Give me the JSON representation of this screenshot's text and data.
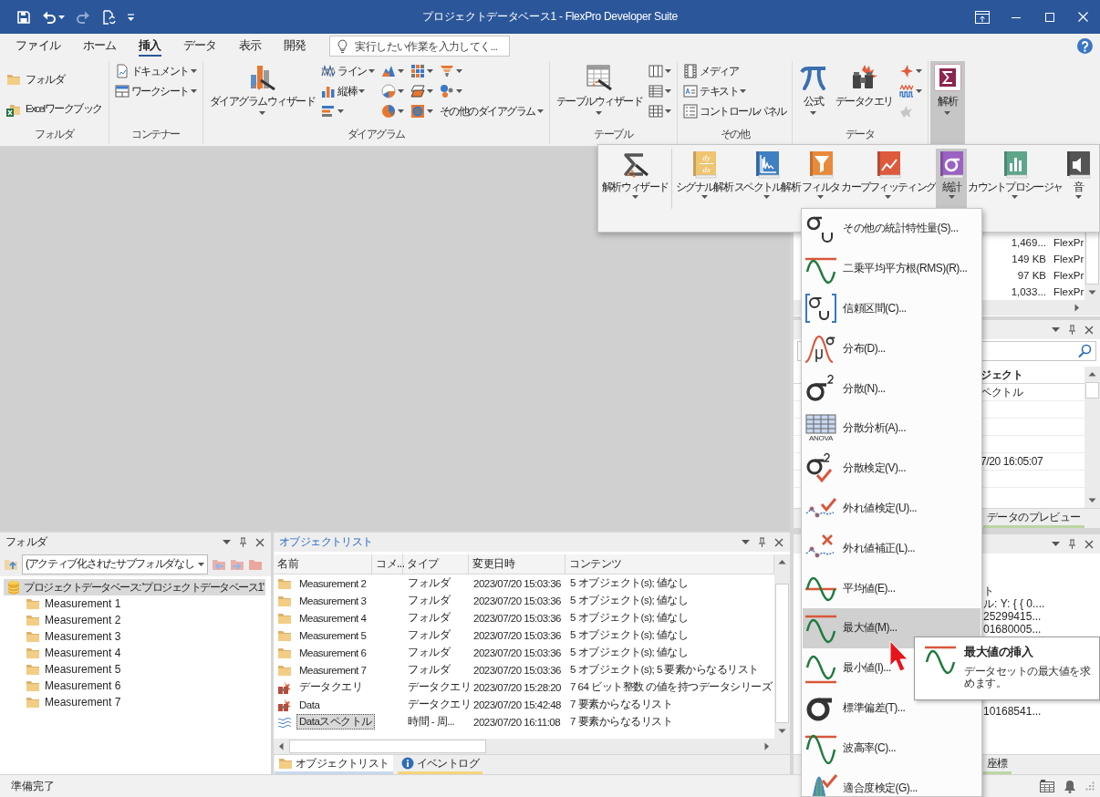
{
  "title_bar": {
    "title": "プロジェクトデータベース1 - FlexPro Developer Suite",
    "quick_access": [
      {
        "dropdown": false,
        "disabled": false
      },
      {
        "dropdown": true,
        "disabled": false
      },
      {
        "dropdown": false,
        "disabled": true
      },
      {
        "dropdown": false,
        "disabled": false
      },
      {
        "dropdown": true,
        "disabled": false
      }
    ]
  },
  "menu": {
    "tabs": [
      {
        "label": "ファイル",
        "selected": false
      },
      {
        "label": "ホーム",
        "selected": false
      },
      {
        "label": "挿入",
        "selected": true
      },
      {
        "label": "データ",
        "selected": false
      },
      {
        "label": "表示",
        "selected": false
      },
      {
        "label": "開発",
        "selected": false
      }
    ],
    "search": {
      "placeholder": "実行したい作業を入力してく..."
    }
  },
  "ribbon": {
    "groups": [
      {
        "label": "フォルダ",
        "buttons": [
          {
            "kind": "medium",
            "label": "フォルダ",
            "dropdown": false
          },
          {
            "kind": "medium",
            "label": "Excelワークブック",
            "dropdown": false
          }
        ]
      },
      {
        "label": "コンテナー",
        "buttons": [
          {
            "kind": "small",
            "label": "ドキュメント",
            "dropdown": true
          },
          {
            "kind": "small",
            "label": "ワークシート",
            "dropdown": true
          }
        ]
      },
      {
        "label": "ダイアグラム",
        "buttons": [
          {
            "kind": "large",
            "label": "ダイアグラムウィザード",
            "dropdown": true
          },
          {
            "kind": "small",
            "label": "ライン",
            "dropdown": true
          },
          {
            "kind": "small",
            "label": "縦棒",
            "dropdown": true
          },
          {
            "kind": "small",
            "dropdown": true
          },
          {
            "kind": "small",
            "dropdown": true
          },
          {
            "kind": "small",
            "dropdown": true
          },
          {
            "kind": "small",
            "dropdown": true
          },
          {
            "kind": "small",
            "dropdown": true
          },
          {
            "kind": "small",
            "dropdown": true
          },
          {
            "kind": "small",
            "dropdown": true
          },
          {
            "kind": "small",
            "dropdown": true
          },
          {
            "kind": "small",
            "dropdown": true
          },
          {
            "kind": "small",
            "label": "その他のダイアグラム",
            "dropdown": true
          }
        ]
      },
      {
        "label": "テーブル",
        "buttons": [
          {
            "kind": "large",
            "label": "テーブルウィザード",
            "dropdown": true
          },
          {
            "kind": "small",
            "dropdown": true
          },
          {
            "kind": "small",
            "dropdown": true
          },
          {
            "kind": "small",
            "dropdown": true
          }
        ]
      },
      {
        "label": "その他",
        "buttons": [
          {
            "kind": "small",
            "label": "メディア",
            "dropdown": false
          },
          {
            "kind": "small",
            "label": "テキスト",
            "dropdown": true
          },
          {
            "kind": "small",
            "label": "コントロールパネル",
            "dropdown": false
          }
        ]
      },
      {
        "label": "データ",
        "buttons": [
          {
            "kind": "large",
            "label": "公式",
            "dropdown": true,
            "disabled": false
          },
          {
            "kind": "large",
            "label": "データクエリ",
            "dropdown": false,
            "disabled": false
          },
          {
            "kind": "small",
            "dropdown": true,
            "disabled": false
          },
          {
            "kind": "small",
            "dropdown": true,
            "disabled": false
          },
          {
            "kind": "small",
            "dropdown": false,
            "disabled": true
          }
        ]
      },
      {
        "buttons": [
          {
            "kind": "large",
            "label": "解析",
            "dropdown": true,
            "pressed": true
          }
        ]
      }
    ]
  },
  "analysis_menu": {
    "groups": [
      [
        {
          "label": "解析ウィザード",
          "dropdown": true,
          "selected": false
        }
      ],
      [
        {
          "label": "シグナル解析",
          "dropdown": true,
          "selected": false,
          "symbol_lines": [
            "dy",
            "dx"
          ]
        },
        {
          "label": "スペクトル解析",
          "dropdown": true,
          "selected": false
        },
        {
          "label": "フィルタ",
          "dropdown": true,
          "selected": false
        },
        {
          "label": "カーブフィッティング",
          "dropdown": true,
          "selected": false
        },
        {
          "label": "統計",
          "dropdown": true,
          "selected": true
        },
        {
          "label": "カウントプロシージャ",
          "dropdown": true,
          "selected": false
        },
        {
          "label": "音",
          "dropdown": true,
          "selected": false
        }
      ]
    ]
  },
  "statistics_menu": {
    "items": [
      {
        "label": "その他の統計特性量(S)...",
        "selected": false
      },
      {
        "label": "二乗平均平方根(RMS)(R)...",
        "selected": false
      },
      {
        "label": "信頼区間(C)...",
        "selected": false
      },
      {
        "label": "分布(D)...",
        "selected": false
      },
      {
        "label": "分散(N)...",
        "selected": false
      },
      {
        "label": "分散分析(A)...",
        "selected": false,
        "icon_caption": "ANOVA"
      },
      {
        "label": "分散検定(V)...",
        "selected": false
      },
      {
        "label": "外れ値検定(U)...",
        "selected": false
      },
      {
        "label": "外れ値補正(L)...",
        "selected": false
      },
      {
        "label": "平均値(E)...",
        "selected": false
      },
      {
        "label": "最大値(M)...",
        "selected": true
      },
      {
        "label": "最小値(I)...",
        "selected": false
      },
      {
        "label": "標準偏差(T)...",
        "selected": false
      },
      {
        "label": "波高率(C)...",
        "selected": false
      },
      {
        "label": "適合度検定(G)...",
        "selected": false
      }
    ]
  },
  "tooltip": {
    "title": "最大値の挿入",
    "text": "データセットの最大値を求めます。"
  },
  "folder_panel": {
    "title": "フォルダ",
    "active": false,
    "combo": {
      "value": "(アクティブ化されたサブフォルダなし"
    },
    "tree": [
      {
        "label": "プロジェクトデータベース: 'プロジェクトデータベース1'",
        "selected": true,
        "children": [
          {
            "label": "Measurement 1",
            "selected": false
          },
          {
            "label": "Measurement 2",
            "selected": false
          },
          {
            "label": "Measurement 3",
            "selected": false
          },
          {
            "label": "Measurement 4",
            "selected": false
          },
          {
            "label": "Measurement 5",
            "selected": false
          },
          {
            "label": "Measurement 6",
            "selected": false
          },
          {
            "label": "Measurement 7",
            "selected": false
          }
        ]
      }
    ]
  },
  "object_list": {
    "title": "オブジェクトリスト",
    "active": true,
    "columns": [
      "名前",
      "コメ...",
      "タイプ",
      "変更日時",
      "コンテンツ"
    ],
    "rows": [
      {
        "kind": "folder",
        "name": "Measurement 2",
        "type": "フォルダ",
        "modified": "2023/07/20 15:03:36",
        "contents": "5 オブジェクト(s); 値なし",
        "selected": false
      },
      {
        "kind": "folder",
        "name": "Measurement 3",
        "type": "フォルダ",
        "modified": "2023/07/20 15:03:36",
        "contents": "5 オブジェクト(s); 値なし",
        "selected": false
      },
      {
        "kind": "folder",
        "name": "Measurement 4",
        "type": "フォルダ",
        "modified": "2023/07/20 15:03:36",
        "contents": "5 オブジェクト(s); 値なし",
        "selected": false
      },
      {
        "kind": "folder",
        "name": "Measurement 5",
        "type": "フォルダ",
        "modified": "2023/07/20 15:03:36",
        "contents": "5 オブジェクト(s); 値なし",
        "selected": false
      },
      {
        "kind": "folder",
        "name": "Measurement 6",
        "type": "フォルダ",
        "modified": "2023/07/20 15:03:36",
        "contents": "5 オブジェクト(s); 値なし",
        "selected": false
      },
      {
        "kind": "folder",
        "name": "Measurement 7",
        "type": "フォルダ",
        "modified": "2023/07/20 15:03:36",
        "contents": "5 オブジェクト(s); 5 要素からなるリスト",
        "selected": false
      },
      {
        "kind": "query",
        "name": "データクエリ",
        "type": "データクエリ",
        "modified": "2023/07/20 15:28:20",
        "contents": "7 64 ビット整数 の値を持つデータシリーズ",
        "selected": false
      },
      {
        "kind": "query",
        "name": "Data",
        "type": "データクエリ",
        "modified": "2023/07/20 15:42:48",
        "contents": "7 要素からなるリスト",
        "selected": false
      },
      {
        "kind": "spectrum",
        "name": "Dataスペクトル",
        "type": "時間 - 周...",
        "modified": "2023/07/20 16:11:08",
        "contents": "7 要素からなるリスト",
        "selected": true
      }
    ],
    "tabs": [
      {
        "kind": "folder",
        "label": "オブジェクトリスト",
        "selected": true,
        "color": "#c9d8ec"
      },
      {
        "kind": "info",
        "label": "イベントログ",
        "selected": false,
        "color": "#f6d47a"
      }
    ]
  },
  "panel_1": {
    "rows": [
      {
        "column_1": "1,469...",
        "column_2": "FlexPr"
      },
      {
        "column_1": "149 KB",
        "column_2": "FlexPr"
      },
      {
        "column_1": "97 KB",
        "column_2": "FlexPr"
      },
      {
        "column_1": "1,033...",
        "column_2": "FlexPr"
      }
    ]
  },
  "panel_2": {
    "column_header": "ジェクト",
    "rows": [
      {
        "text": "ペクトル"
      },
      {},
      {},
      {},
      {
        "text": "7/20 16:05:07"
      },
      {}
    ],
    "tabs": [
      {
        "label": "データのプレビュー",
        "color": "#bcd6a4"
      }
    ]
  },
  "panel_3": {
    "text_blocks": [
      [
        "ト",
        "ル: Y: { { 0....",
        "25299415...",
        "01680005..."
      ],
      [
        "10168541..."
      ]
    ],
    "tabs": [
      {
        "label": "座標",
        "color": "#bcd6a4"
      }
    ]
  },
  "status_bar": {
    "text": "準備完了"
  }
}
